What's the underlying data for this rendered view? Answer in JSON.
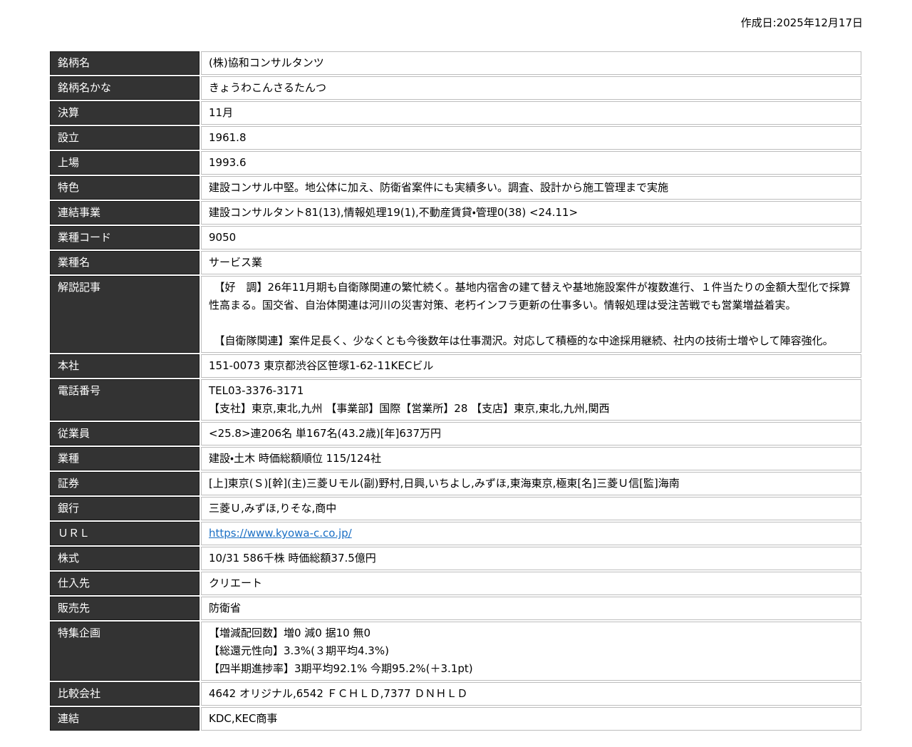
{
  "page": {
    "created_date": "作成日:2025年12月17日"
  },
  "table": {
    "rows": [
      {
        "label": "銘柄名",
        "value": "(株)協和コンサルタンツ"
      },
      {
        "label": "銘柄名かな",
        "value": "きょうわこんさるたんつ"
      },
      {
        "label": "決算",
        "value": "11月"
      },
      {
        "label": "設立",
        "value": "1961.8"
      },
      {
        "label": "上場",
        "value": "1993.6"
      },
      {
        "label": "特色",
        "value": "建設コンサル中堅。地公体に加え、防衛省案件にも実績多い。調査、設計から施工管理まで実施"
      },
      {
        "label": "連結事業",
        "value": "建設コンサルタント81(13),情報処理19(1),不動産賃貸・管理0(38) <24.11>"
      },
      {
        "label": "業種コード",
        "value": "9050"
      },
      {
        "label": "業種名",
        "value": "サービス業"
      },
      {
        "label": "解説記事",
        "paragraphs": [
          "　【好　調】26年11月期も自衛隊関連の繁忙続く。基地内宿舎の建て替えや基地施設案件が複数進行、１件当たりの金額大型化で採算性高まる。国交省、自治体関連は河川の災害対策、老朽インフラ更新の仕事多い。情報処理は受注苦戦でも営業増益着実。",
          "　【自衛隊関連】案件足長く、少なくとも今後数年は仕事潤沢。対応して積極的な中途採用継続、社内の技術士増やして陣容強化。"
        ]
      },
      {
        "label": "本社",
        "value": "151-0073 東京都渋谷区笹塚1-62-11KECビル"
      },
      {
        "label": "電話番号",
        "lines": [
          "TEL03-3376-3171",
          "【支社】東京,東北,九州 【事業部】国際【営業所】28 【支店】東京,東北,九州,関西"
        ]
      },
      {
        "label": "従業員",
        "value": "<25.8>連206名 単167名(43.2歳)[年]637万円"
      },
      {
        "label": "業種",
        "value": "建設・土木 時価総額順位 115/124社"
      },
      {
        "label": "証券",
        "value": "[上]東京(Ｓ)[幹](主)三菱Ｕモル(副)野村,日興,いちよし,みずほ,東海東京,極東[名]三菱Ｕ信[監]海南"
      },
      {
        "label": "銀行",
        "value": "三菱Ｕ,みずほ,りそな,商中"
      },
      {
        "label": "ＵＲＬ",
        "value": "https://www.kyowa-c.co.jp/"
      },
      {
        "label": "株式",
        "value": "10/31 586千株 時価総額37.5億円"
      },
      {
        "label": "仕入先",
        "value": "クリエート"
      },
      {
        "label": "販売先",
        "value": "防衛省"
      },
      {
        "label": "特集企画",
        "lines": [
          "【増減配回数】増0 減0 据10 無0",
          "【総還元性向】3.3%(３期平均4.3%)",
          "【四半期進捗率】3期平均92.1% 今期95.2%(＋3.1pt)"
        ]
      },
      {
        "label": "比較会社",
        "value": "4642 オリジナル,6542 ＦＣＨＬＤ,7377 ＤＮＨＬＤ"
      },
      {
        "label": "連結",
        "value": "KDC,KEC商事"
      }
    ]
  }
}
